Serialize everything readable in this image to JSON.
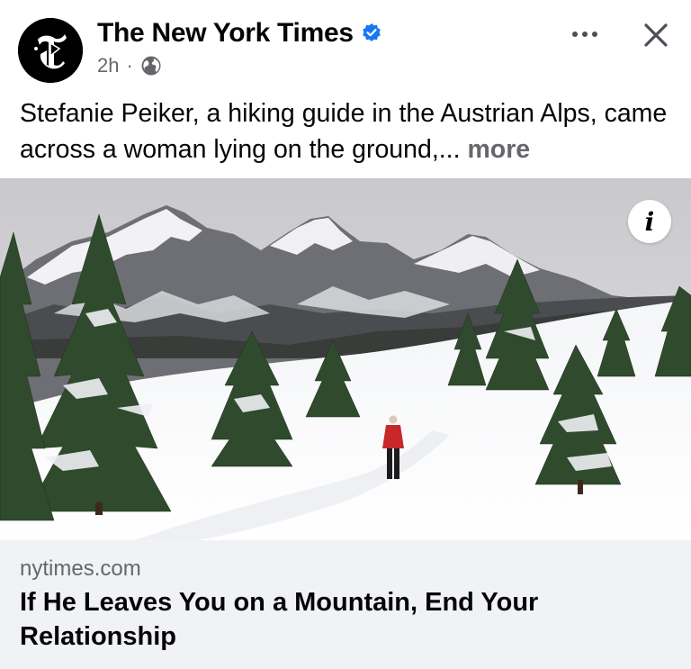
{
  "post": {
    "page_name": "The New York Times",
    "timestamp": "2h",
    "separator": "·",
    "audience_icon": "globe-icon",
    "verified_icon": "verified-badge-icon",
    "caption": "Stefanie Peiker, a hiking guide in the Austrian Alps, came across a woman lying on the ground,...",
    "more_label": "more",
    "photo_info_label": "i"
  },
  "link_preview": {
    "domain": "nytimes.com",
    "title": "If He Leaves You on a Mountain, End Your Relationship"
  },
  "colors": {
    "verified_blue": "#1877f2",
    "secondary_text": "#65676b",
    "link_card_bg": "#f0f2f5",
    "hiker_jacket": "#c8282a"
  }
}
